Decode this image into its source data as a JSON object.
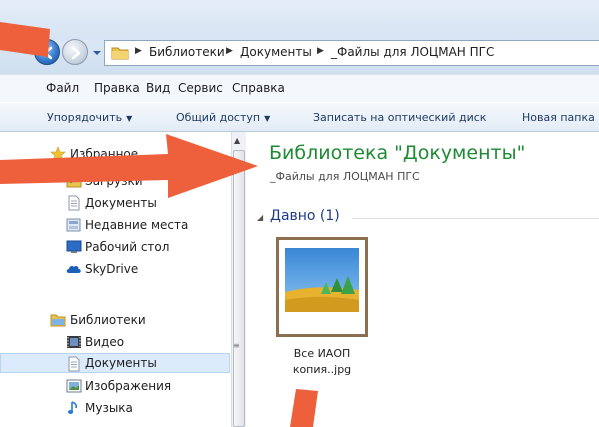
{
  "window": {
    "breadcrumbs": [
      "Библиотеки",
      "Документы",
      "_Файлы для ЛОЦМАН ПГС"
    ]
  },
  "menubar": {
    "items": [
      "Файл",
      "Правка",
      "Вид",
      "Сервис",
      "Справка"
    ]
  },
  "commandbar": {
    "items": [
      "Упорядочить",
      "Общий доступ",
      "Записать на оптический диск",
      "Новая папка"
    ]
  },
  "navpane": {
    "favorites": {
      "label": "Избранное",
      "items": [
        "Загрузки",
        "Документы",
        "Недавние места",
        "Рабочий стол",
        "SkyDrive"
      ]
    },
    "libraries": {
      "label": "Библиотеки",
      "items": [
        "Видео",
        "Документы",
        "Изображения",
        "Музыка"
      ]
    }
  },
  "content": {
    "title": "Библиотека \"Документы\"",
    "subtitle": "_Файлы для ЛОЦМАН ПГС",
    "group_label": "Давно (1)",
    "file": {
      "name_line1": "Все ИАОП",
      "name_line2": "копия..jpg"
    }
  },
  "colors": {
    "title_green": "#1f8a34",
    "annotation_orange": "#ee5f3c",
    "selection_blue": "#dcebfc"
  }
}
